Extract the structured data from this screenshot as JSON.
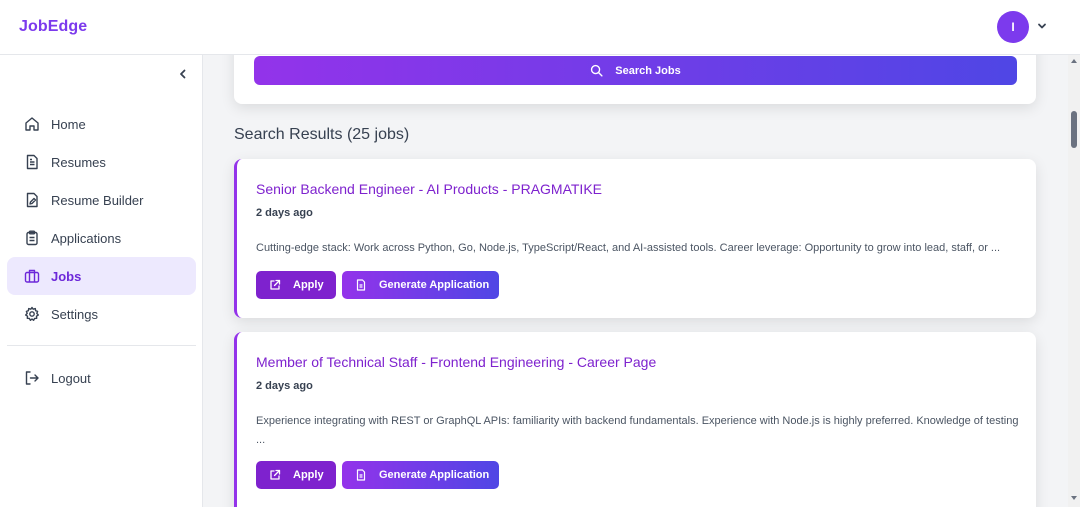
{
  "brand": "JobEdge",
  "user": {
    "initial": "I"
  },
  "sidebar": {
    "items": [
      {
        "label": "Home",
        "icon": "home-icon",
        "active": false
      },
      {
        "label": "Resumes",
        "icon": "document-icon",
        "active": false
      },
      {
        "label": "Resume Builder",
        "icon": "file-edit-icon",
        "active": false
      },
      {
        "label": "Applications",
        "icon": "clipboard-icon",
        "active": false
      },
      {
        "label": "Jobs",
        "icon": "briefcase-icon",
        "active": true
      },
      {
        "label": "Settings",
        "icon": "gear-icon",
        "active": false
      }
    ],
    "logout": "Logout"
  },
  "search": {
    "button_label": "Search Jobs"
  },
  "results": {
    "title": "Search Results (25 jobs)",
    "jobs": [
      {
        "title": "Senior Backend Engineer - AI Products - PRAGMATIKE",
        "date": "2 days ago",
        "description": "Cutting-edge stack: Work across Python, Go, Node.js, TypeScript/React, and AI-assisted tools. Career leverage: Opportunity to grow into lead, staff, or ...",
        "apply_label": "Apply",
        "generate_label": "Generate Application"
      },
      {
        "title": "Member of Technical Staff - Frontend Engineering - Career Page",
        "date": "2 days ago",
        "description": "Experience integrating with REST or GraphQL APIs: familiarity with backend fundamentals. Experience with Node.js is highly preferred. Knowledge of testing ...",
        "apply_label": "Apply",
        "generate_label": "Generate Application"
      }
    ]
  },
  "colors": {
    "accent": "#7c3aed",
    "gradient_start": "#9333ea",
    "gradient_end": "#4f46e5",
    "active_bg": "#ede9fe"
  }
}
